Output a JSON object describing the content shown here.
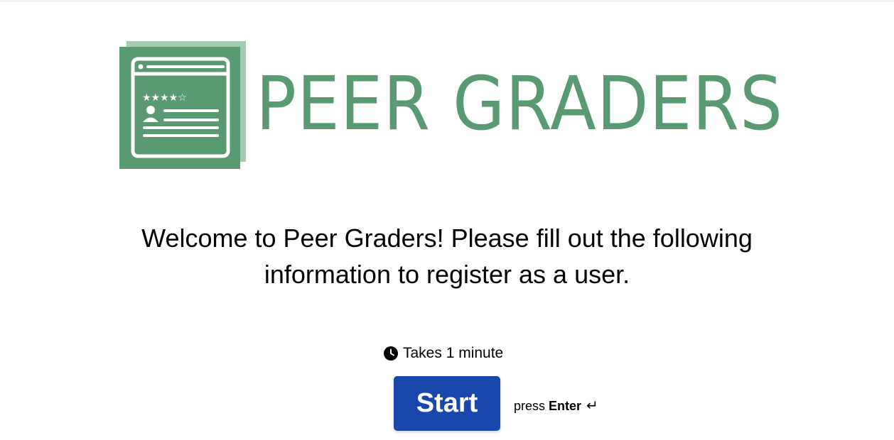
{
  "brand": {
    "name": "PEER GRADERS",
    "color": "#5a9a72",
    "icon": "review-card-logo-icon"
  },
  "main": {
    "welcome_text": "Welcome to Peer Graders! Please fill out the following information to register as a user.",
    "duration_text": "Takes 1 minute",
    "duration_icon": "clock-icon",
    "start_label": "Start",
    "start_color": "#1a47ab",
    "press_label": "press",
    "key_label": "Enter",
    "enter_icon": "↵"
  }
}
